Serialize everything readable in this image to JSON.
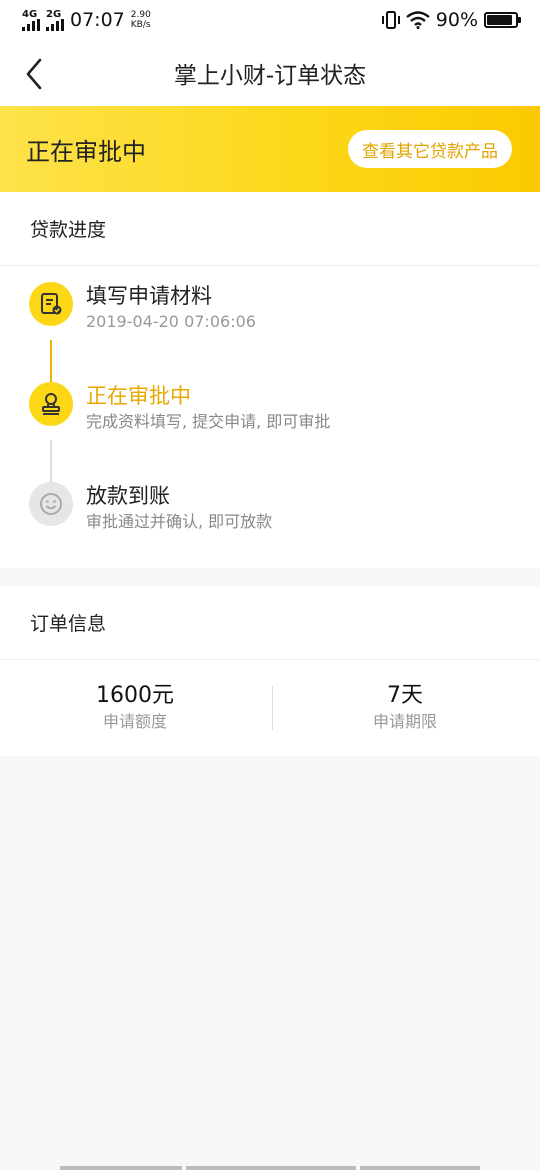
{
  "status_bar": {
    "net1": "4G",
    "net2": "2G",
    "time": "07:07",
    "speed_value": "2.90",
    "speed_unit": "KB/s",
    "battery_text": "90%",
    "battery_level": 0.9
  },
  "header": {
    "title": "掌上小财-订单状态"
  },
  "banner": {
    "status": "正在审批中",
    "button_label": "查看其它贷款产品",
    "accent": "#fcd716"
  },
  "progress": {
    "section_title": "贷款进度",
    "steps": [
      {
        "title": "填写申请材料",
        "sub": "2019-04-20 07:06:06",
        "state": "done"
      },
      {
        "title": "正在审批中",
        "sub": "完成资料填写, 提交申请, 即可审批",
        "state": "active"
      },
      {
        "title": "放款到账",
        "sub": "审批通过并确认, 即可放款",
        "state": "pending"
      }
    ]
  },
  "order": {
    "section_title": "订单信息",
    "amount_value": "1600元",
    "amount_label": "申请额度",
    "term_value": "7天",
    "term_label": "申请期限"
  }
}
